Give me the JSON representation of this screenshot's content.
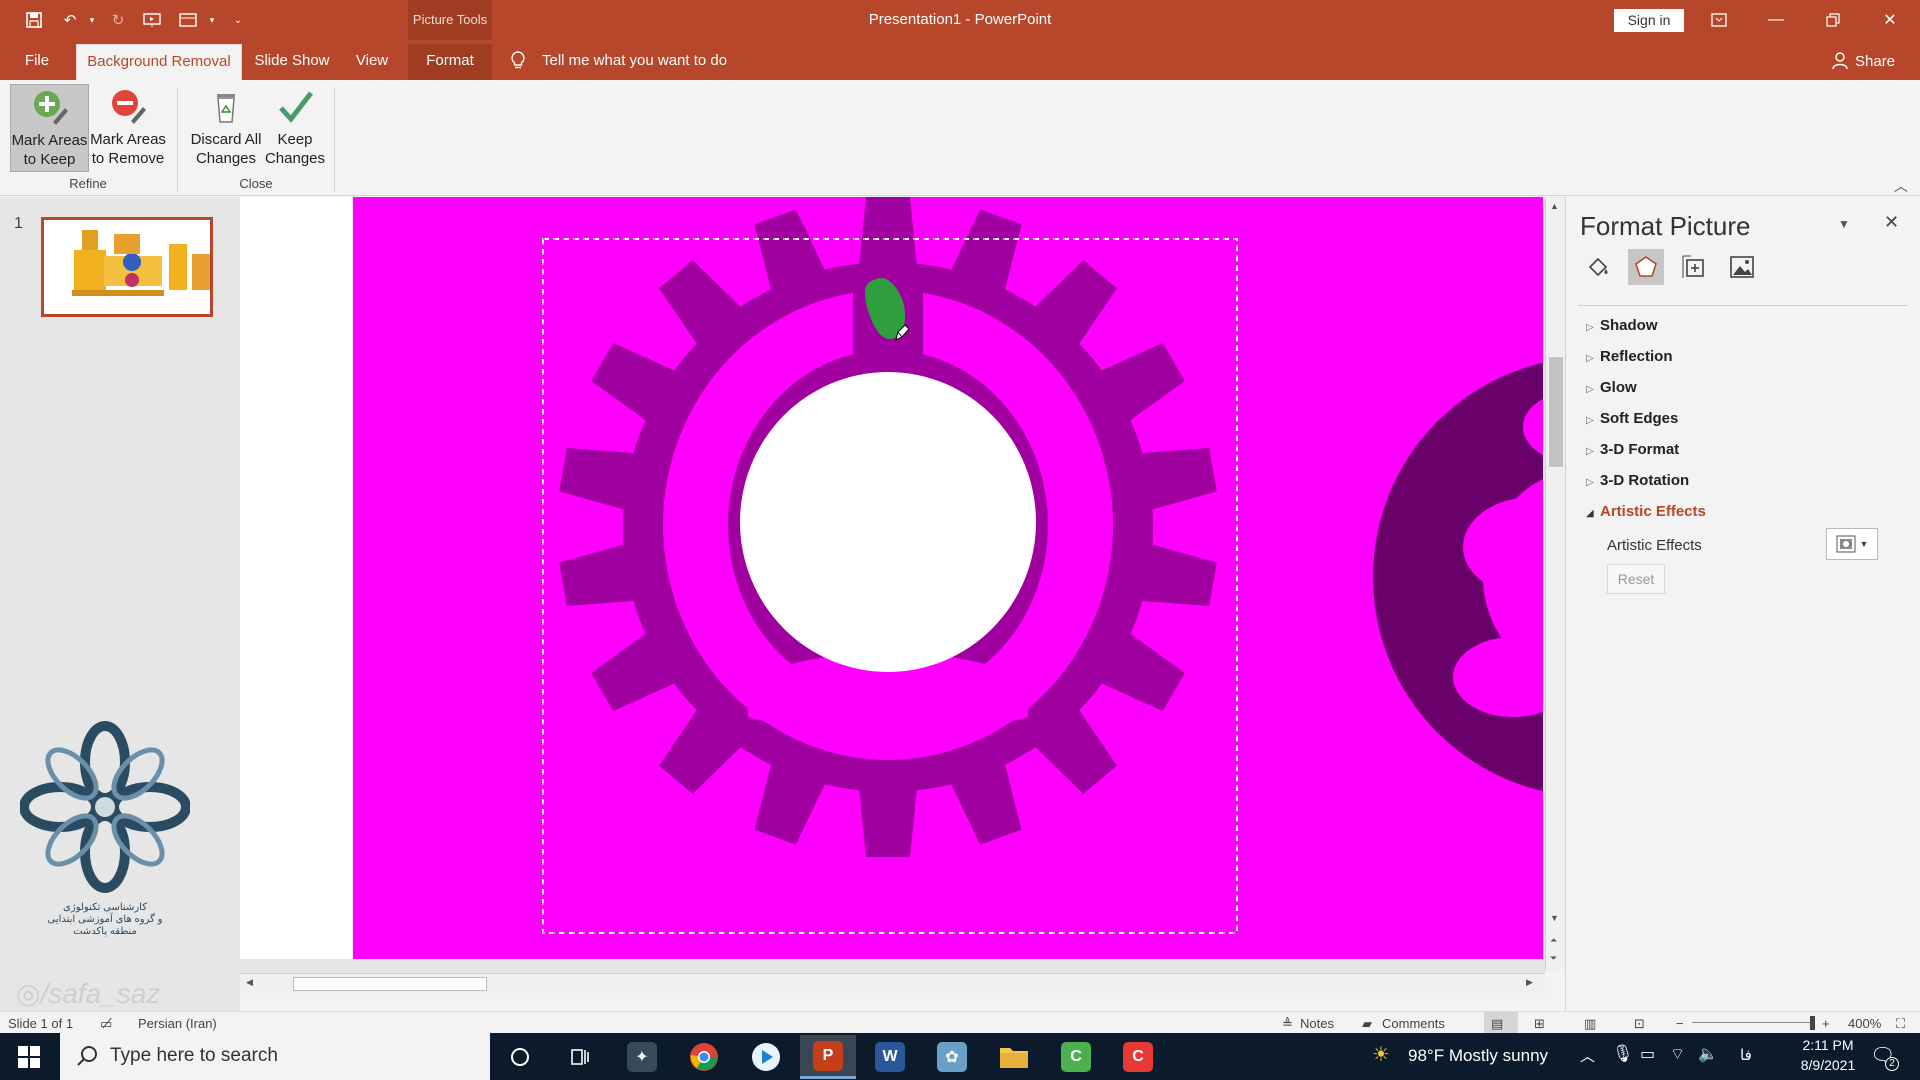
{
  "titlebar": {
    "contextual_tab_group": "Picture Tools",
    "window_title": "Presentation1  -  PowerPoint",
    "sign_in": "Sign in"
  },
  "tabs": [
    {
      "label": "File"
    },
    {
      "label": "Background Removal",
      "active": true
    },
    {
      "label": "Slide Show"
    },
    {
      "label": "View"
    },
    {
      "label": "Format"
    }
  ],
  "tell_me": "Tell me what you want to do",
  "share": "Share",
  "ribbon": {
    "mark_keep": {
      "line1": "Mark Areas",
      "line2": "to Keep"
    },
    "mark_remove": {
      "line1": "Mark Areas",
      "line2": "to Remove"
    },
    "discard": {
      "line1": "Discard All",
      "line2": "Changes"
    },
    "keep": {
      "line1": "Keep",
      "line2": "Changes"
    },
    "groups": {
      "refine": "Refine",
      "close": "Close"
    }
  },
  "thumbnails": {
    "slide_number": "1"
  },
  "watermark": {
    "caption_line1": "کارشناسی تکنولوژی",
    "caption_line2": "و گروه های آموزشی ابتدایی",
    "caption_line3": "منطقه پاکدشت",
    "handle": "/safa_saz"
  },
  "format_pane": {
    "title": "Format Picture",
    "sections": [
      {
        "label": "Shadow",
        "expanded": false
      },
      {
        "label": "Reflection",
        "expanded": false
      },
      {
        "label": "Glow",
        "expanded": false
      },
      {
        "label": "Soft Edges",
        "expanded": false
      },
      {
        "label": "3-D Format",
        "expanded": false
      },
      {
        "label": "3-D Rotation",
        "expanded": false
      },
      {
        "label": "Artistic Effects",
        "expanded": true
      }
    ],
    "artistic_effects_label": "Artistic Effects",
    "reset_label": "Reset"
  },
  "statusbar": {
    "slide_info": "Slide 1 of 1",
    "language": "Persian (Iran)",
    "notes": "Notes",
    "comments": "Comments",
    "zoom": "400%"
  },
  "taskbar": {
    "search_placeholder": "Type here to search",
    "weather": "98°F  Mostly sunny",
    "lang_indicator": "فا",
    "time": "2:11 PM",
    "date": "8/9/2021",
    "notification_count": "2"
  },
  "colors": {
    "accent": "#b7472a",
    "remove_area": "#ff00ff",
    "gear": "#a000a0",
    "keep_mark": "#2e9e3f"
  }
}
